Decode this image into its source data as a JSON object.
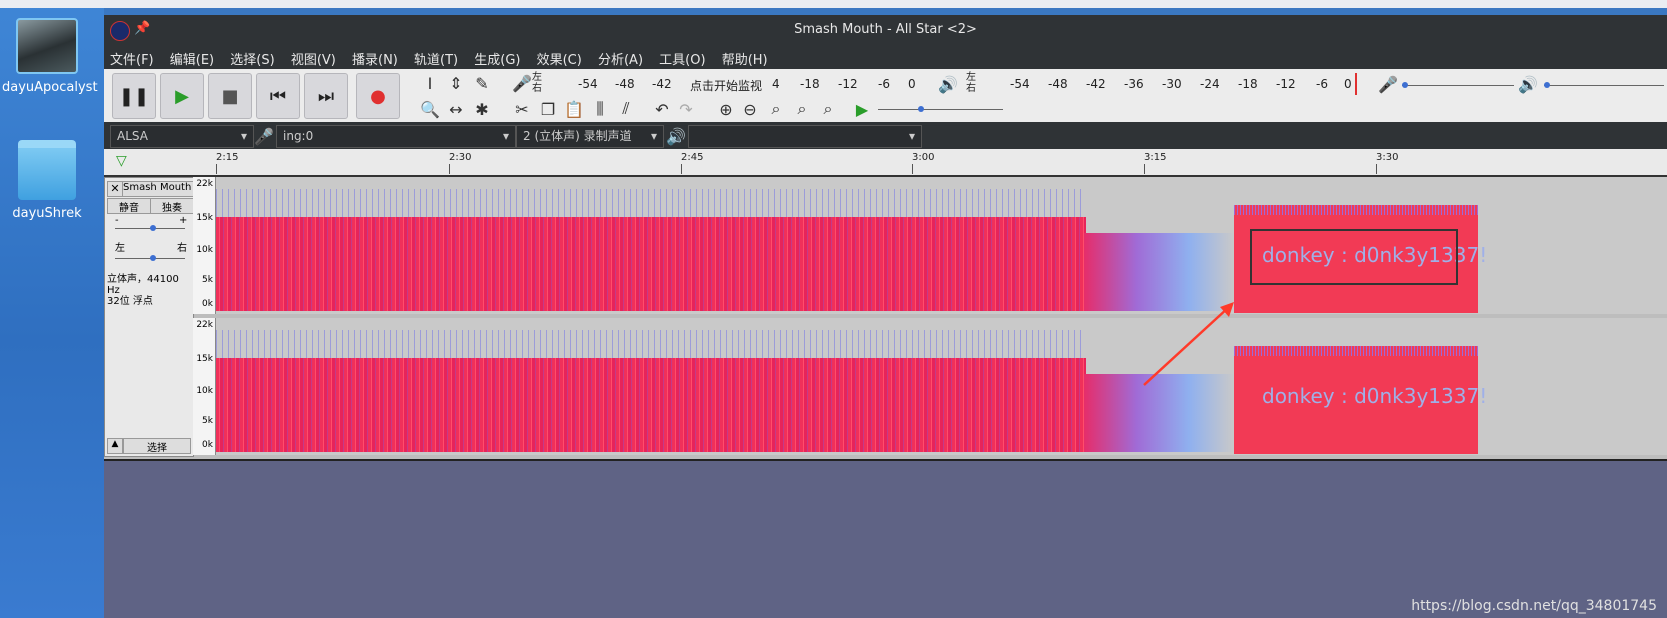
{
  "desktop": {
    "icons": [
      {
        "label": "dayuApocalyst"
      },
      {
        "label": "dayuShrek"
      }
    ]
  },
  "window": {
    "title": "Smash Mouth - All Star <2>"
  },
  "menu": [
    "文件(F)",
    "编辑(E)",
    "选择(S)",
    "视图(V)",
    "播录(N)",
    "轨道(T)",
    "生成(G)",
    "效果(C)",
    "分析(A)",
    "工具(O)",
    "帮助(H)"
  ],
  "meter_rec": {
    "lr_top": "左",
    "lr_bottom": "右",
    "ticks": [
      "-54",
      "-48",
      "-42",
      "点击开始监视",
      "4",
      "-18",
      "-12",
      "-6",
      "0"
    ]
  },
  "meter_play": {
    "lr_top": "左",
    "lr_bottom": "右",
    "ticks": [
      "-54",
      "-48",
      "-42",
      "-36",
      "-30",
      "-24",
      "-18",
      "-12",
      "-6",
      "0"
    ]
  },
  "devices": {
    "host": "ALSA",
    "input": "ing:0",
    "channels": "2 (立体声) 录制声道",
    "output": ""
  },
  "ruler": {
    "ticks": [
      "2:15",
      "2:30",
      "2:45",
      "3:00",
      "3:15",
      "3:30"
    ]
  },
  "track": {
    "name": "Smash Mouth",
    "mute": "静音",
    "solo": "独奏",
    "gain_minus": "-",
    "gain_plus": "+",
    "pan_left": "左",
    "pan_right": "右",
    "info_line1": "立体声，44100 Hz",
    "info_line2": "32位 浮点",
    "select": "选择"
  },
  "scale": [
    "22k",
    "15k",
    "10k",
    "5k",
    "0k"
  ],
  "hidden_text": "donkey : d0nk3y1337!",
  "watermark": "https://blog.csdn.net/qq_34801745"
}
